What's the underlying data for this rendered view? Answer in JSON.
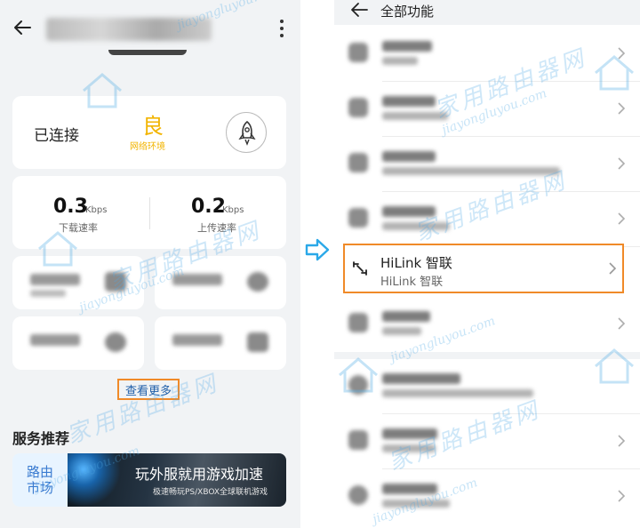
{
  "left": {
    "status": {
      "connected": "已连接",
      "quality": "良",
      "quality_sub": "网络环境"
    },
    "speed": {
      "download_value": "0.3",
      "download_unit": "Kbps",
      "download_label": "下载速率",
      "upload_value": "0.2",
      "upload_unit": "Kbps",
      "upload_label": "上传速率"
    },
    "see_more": "查看更多",
    "section_title": "服务推荐",
    "banner": {
      "left_line1": "路由",
      "left_line2": "市场",
      "title": "玩外服就用游戏加速",
      "subtitle": "极速畅玩PS/XBOX全球联机游戏"
    }
  },
  "right": {
    "title": "全部功能",
    "highlight": {
      "name": "HiLink 智联",
      "sub": "HiLink 智联"
    }
  },
  "watermark": {
    "domain": "jiayongluyou.com",
    "cn": "家用路由器网"
  },
  "colors": {
    "highlight": "#f08a28",
    "quality": "#f2b400",
    "link": "#1f5ea8",
    "arrow": "#2aa8e8"
  }
}
